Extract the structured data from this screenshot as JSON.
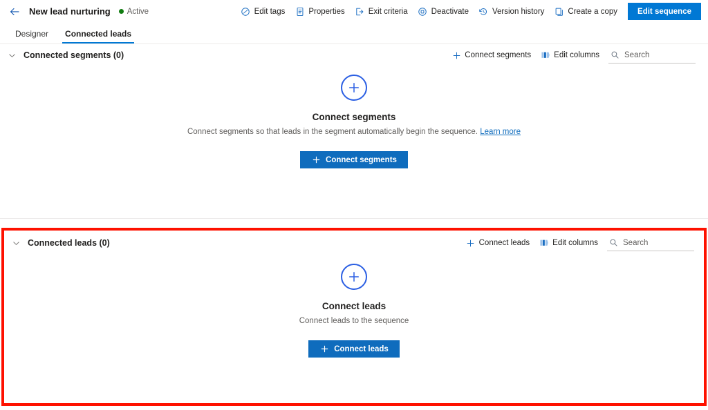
{
  "header": {
    "back_icon": "arrow-left-icon",
    "title": "New lead nurturing",
    "status": "Active",
    "status_color": "#107c10",
    "actions": [
      {
        "label": "Edit tags",
        "icon": "tag-icon"
      },
      {
        "label": "Properties",
        "icon": "document-properties-icon"
      },
      {
        "label": "Exit criteria",
        "icon": "exit-icon"
      },
      {
        "label": "Deactivate",
        "icon": "deactivate-circle-icon"
      },
      {
        "label": "Version history",
        "icon": "history-icon"
      },
      {
        "label": "Create a copy",
        "icon": "copy-icon"
      }
    ],
    "primary_button": "Edit sequence",
    "primary_color": "#0078d4"
  },
  "tabs": [
    {
      "label": "Designer",
      "active": false
    },
    {
      "label": "Connected leads",
      "active": true
    }
  ],
  "segments_section": {
    "chevron_icon": "chevron-down-icon",
    "title": "Connected segments (0)",
    "tools": [
      {
        "label": "Connect segments",
        "icon": "plus-icon"
      },
      {
        "label": "Edit columns",
        "icon": "columns-icon"
      }
    ],
    "search": {
      "placeholder": "Search",
      "value": "",
      "icon": "search-icon"
    },
    "empty": {
      "icon": "plus-circle-icon",
      "title": "Connect segments",
      "description": "Connect segments so that leads in the segment automatically begin the sequence.",
      "link": "Learn more",
      "cta": "Connect segments"
    }
  },
  "leads_section": {
    "chevron_icon": "chevron-down-icon",
    "title": "Connected leads (0)",
    "tools": [
      {
        "label": "Connect leads",
        "icon": "plus-icon"
      },
      {
        "label": "Edit columns",
        "icon": "columns-icon"
      }
    ],
    "search": {
      "placeholder": "Search",
      "value": "",
      "icon": "search-icon"
    },
    "empty": {
      "icon": "plus-circle-icon",
      "title": "Connect leads",
      "description": "Connect leads to the sequence",
      "cta": "Connect leads"
    },
    "highlight_color": "#fe1100"
  }
}
